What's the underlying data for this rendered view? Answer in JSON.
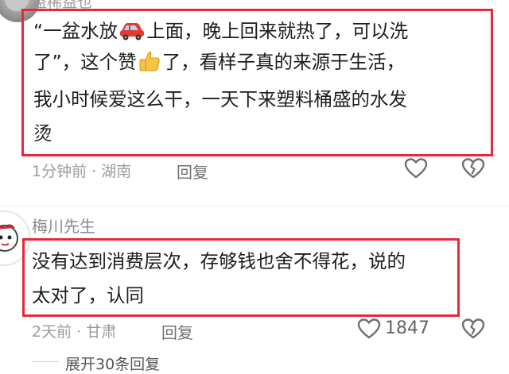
{
  "comments": [
    {
      "username": "益稀益也",
      "text_lines": [
        [
          "“一盆水放",
          "上面，晚上回来就热了，可以洗"
        ],
        [
          "了”，这个赞",
          "了，看样子真的来源于生活，"
        ],
        [
          "我小时候爱这么干，一天下来塑料桶盛的水发"
        ],
        [
          "烫"
        ]
      ],
      "emojis": [
        "car-emoji",
        "thumbs-up-emoji"
      ],
      "time_location": "1分钟前 · 湖南",
      "reply_label": "回复",
      "like_count": ""
    },
    {
      "username": "梅川先生",
      "text_lines": [
        [
          "没有达到消费层次，存够钱也舍不得花，说的"
        ],
        [
          "太对了，认同"
        ]
      ],
      "time_location": "2天前 · 甘肃",
      "reply_label": "回复",
      "like_count": "1847"
    }
  ],
  "more_replies": "展开30条回复",
  "colors": {
    "highlight": "#e8283a",
    "text": "#1d1d1d",
    "meta": "#9b9b9b"
  },
  "icons": [
    "heart-outline-icon",
    "broken-heart-icon",
    "car-emoji",
    "thumbs-up-emoji"
  ]
}
